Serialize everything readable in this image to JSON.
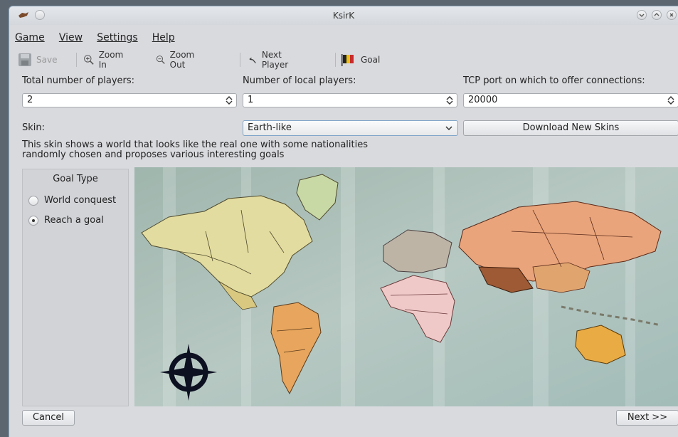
{
  "window": {
    "title": "KsirK"
  },
  "menu": [
    {
      "label": "Game"
    },
    {
      "label": "View"
    },
    {
      "label": "Settings"
    },
    {
      "label": "Help"
    }
  ],
  "toolbar": {
    "save": "Save",
    "zoom_in": "Zoom In",
    "zoom_out": "Zoom Out",
    "next_player": "Next Player",
    "goal": "Goal"
  },
  "players": {
    "total_label": "Total number of players:",
    "total_value": "2",
    "local_label": "Number of local players:",
    "local_value": "1",
    "port_label": "TCP port on which to offer connections:",
    "port_value": "20000"
  },
  "skin": {
    "label": "Skin:",
    "selected": "Earth-like",
    "download_button": "Download New Skins",
    "description_line1": "This skin shows a world that looks like the real one with some nationalities",
    "description_line2": "randomly chosen and proposes various interesting goals"
  },
  "goal_type": {
    "title": "Goal Type",
    "options": [
      {
        "label": "World conquest",
        "selected": false
      },
      {
        "label": "Reach a goal",
        "selected": true
      }
    ]
  },
  "footer": {
    "cancel": "Cancel",
    "next": "Next >>"
  },
  "colors": {
    "window_bg": "#d9dade",
    "ocean": "#a8bfb8",
    "america_north": "#e3dca0",
    "greenland": "#c9d9a6",
    "south_america": "#e7a55d",
    "africa": "#efc9c8",
    "russia": "#e9a47b",
    "australia": "#e9ab43"
  }
}
